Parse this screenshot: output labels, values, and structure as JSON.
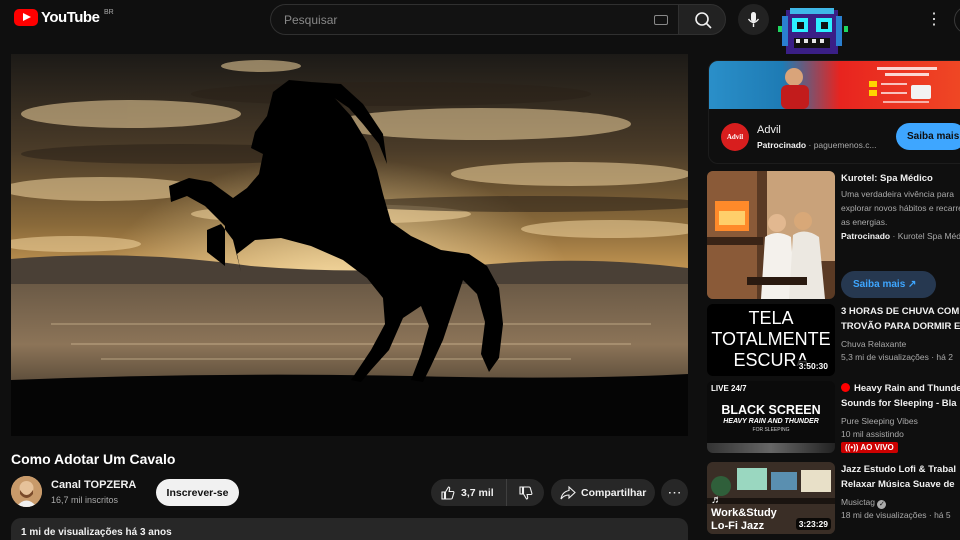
{
  "header": {
    "logo_text": "YouTube",
    "country_code": "BR",
    "search_placeholder": "Pesquisar"
  },
  "video": {
    "title": "Como Adotar Um Cavalo",
    "channel_name": "Canal TOPZERA",
    "subscribers": "16,7 mil inscritos",
    "subscribe_label": "Inscrever-se",
    "likes": "3,7 mil",
    "share_label": "Compartilhar",
    "views_date": "1 mi de visualizações  há 3 anos"
  },
  "ad": {
    "name": "Advil",
    "sponsored": "Patrocinado",
    "domain": "paguemenos.c...",
    "cta": "Saiba mais",
    "logo_text": "Advil"
  },
  "sidebar": [
    {
      "title": "Kurotel: Spa Médico",
      "desc1": "Uma verdadeira vivência para",
      "desc2": "explorar novos hábitos e recarregar",
      "desc3": "as energias.",
      "sponsored": "Patrocinado",
      "advertiser": "Kurotel Spa Médico",
      "cta": "Saiba mais"
    },
    {
      "title1": "3 HORAS DE CHUVA COM",
      "title2": "TROVÃO PARA DORMIR E",
      "channel": "Chuva Relaxante",
      "meta": "5,3 mi de visualizações · há 2",
      "duration": "3:50:30",
      "thumb_text1": "TELA",
      "thumb_text2": "TOTALMENTE",
      "thumb_text3": "ESCURA"
    },
    {
      "title1": "Heavy Rain and Thunder",
      "title2": "Sounds for Sleeping - Bla",
      "channel": "Pure Sleeping Vibes",
      "meta": "10 mil assistindo",
      "live_badge": "AO VIVO",
      "thumb_live": "LIVE 24/7",
      "thumb_text1": "BLACK SCREEN",
      "thumb_text2": "HEAVY RAIN AND THUNDER",
      "thumb_text3": "FOR SLEEPING"
    },
    {
      "title1": "Jazz Estudo Lofi & Trabal",
      "title2": "Relaxar Música Suave de",
      "channel": "Musictag",
      "meta": "18 mi de visualizações · há 5",
      "duration": "3:23:29",
      "thumb_text1": "Work&Study",
      "thumb_text2": "Lo-Fi Jazz"
    }
  ],
  "colors": {
    "background": "#0f0f0f",
    "accent_blue": "#3ea6ff",
    "youtube_red": "#ff0000",
    "live_red": "#cc0000"
  }
}
